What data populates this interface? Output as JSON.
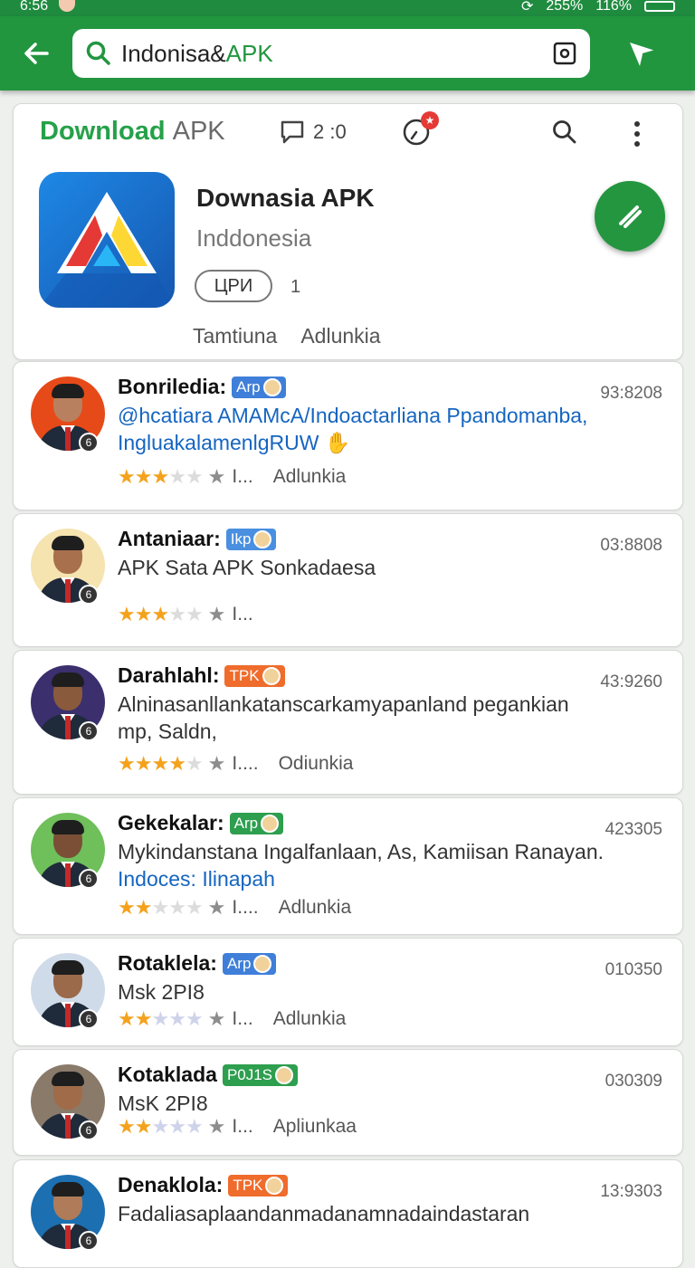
{
  "status": {
    "time": "6:56",
    "signal": "255%",
    "battery": "116%"
  },
  "search": {
    "query_prefix": "Indonisa&",
    "query_highlight": "APK"
  },
  "header": {
    "brand_main": "Download",
    "brand_suffix": "APK",
    "comment_count": "2 :0",
    "clock_badge": "★",
    "app_name": "Downasia APK",
    "app_subtitle": "Inddonesia",
    "chip_label": "ЦРИ",
    "chip_count": "1",
    "tab_1": "Tamtiuna",
    "tab_2": "Adlunkia"
  },
  "rows": [
    {
      "name": "Bonriledia:",
      "tag": "Arp",
      "tag_color": "#3f7fd9",
      "time": "93:8208",
      "line1": "@hcatiara AMAMcA/Indoactarliana Ppandomanba,",
      "line1_blue": true,
      "line2": "IngluakalamenlgRUW ✋",
      "line2_blue": true,
      "rating": 3,
      "ellipsis": "I...",
      "action": "Adlunkia",
      "rate_top": 114,
      "avatar_bg": "#e64a19",
      "skin": "#b98060"
    },
    {
      "name": "Antaniaar:",
      "tag": "Ikp",
      "tag_color": "#4a8fe0",
      "time": "03:8808",
      "line1": "APK Sata APK Sonkadaesa",
      "line1_blue": false,
      "line2": "",
      "line2_blue": false,
      "rating": 3,
      "ellipsis": "I...",
      "action": "",
      "rate_top": 98,
      "avatar_bg": "#f5e3b0",
      "skin": "#a8704c"
    },
    {
      "name": "Darahlahl:",
      "tag": "TPK",
      "tag_color": "#ef6c2c",
      "time": "43:9260",
      "line1": "Alninasanllankatanscarkamyapanland pegankian",
      "line1_blue": false,
      "line2": "mp, Saldn,",
      "line2_blue": false,
      "rating": 4,
      "ellipsis": "I....",
      "action": "Odiunkia",
      "rate_top": 112,
      "avatar_bg": "#3b2f6e",
      "skin": "#8a5a3c"
    },
    {
      "name": "Gekekalar:",
      "tag": "Arp",
      "tag_color": "#2e9e4f",
      "time": "423305",
      "line1": "Mykindanstana Ingalfanlaan, As, Kamiisan Ranayan.",
      "line1_blue": false,
      "line2": "Indoces: Ilinapah",
      "line2_blue": true,
      "rating": 2,
      "ellipsis": "I....",
      "action": "Adlunkia",
      "rate_top": 108,
      "avatar_bg": "#6fbf5b",
      "skin": "#7a4f36"
    },
    {
      "name": "Rotaklela:",
      "tag": "Arp",
      "tag_color": "#3f7fd9",
      "time": "010350",
      "line1": "Msk 2PI8",
      "line1_blue": false,
      "line2": "",
      "line2_blue": false,
      "rating": 2,
      "ellipsis": "I...",
      "action": "Adlunkia",
      "rate_top": 76,
      "avatar_bg": "#cfdbe8",
      "skin": "#9b6a4a"
    },
    {
      "name": "Kotaklada",
      "tag": "P0J1S",
      "tag_color": "#2e9e4f",
      "time": "030309",
      "line1": "MsK 2PI8",
      "line1_blue": false,
      "line2": "",
      "line2_blue": false,
      "rating": 2,
      "ellipsis": "I...",
      "action": "Apliunkaa",
      "rate_top": 72,
      "avatar_bg": "#8a7a6a",
      "skin": "#a06b48"
    },
    {
      "name": "Denaklola:",
      "tag": "TPK",
      "tag_color": "#ef6c2c",
      "time": "13:9303",
      "line1": "Fadaliasaplaandanmadanamnadaindastaran",
      "line1_blue": false,
      "line2": "",
      "line2_blue": false,
      "rating": 0,
      "ellipsis": "",
      "action": "",
      "rate_top": 0,
      "avatar_bg": "#1c6fb0",
      "skin": "#b07b58"
    }
  ],
  "colors": {
    "primary": "#22963f",
    "accent_star": "#f4a21d",
    "link_blue": "#1565c0"
  }
}
